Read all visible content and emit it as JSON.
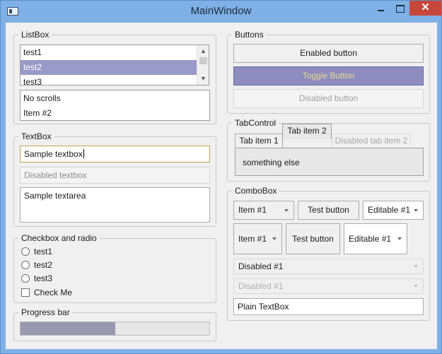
{
  "window": {
    "title": "MainWindow",
    "close_glyph": "✕"
  },
  "listbox_group": {
    "legend": "ListBox",
    "list1": [
      "test1",
      "test2",
      "test3"
    ],
    "list1_selected_index": 1,
    "list2": [
      "No scrolls",
      "Item #2"
    ]
  },
  "textbox_group": {
    "legend": "TextBox",
    "sample_textbox": "Sample textbox",
    "disabled_textbox": "Disabled textbox",
    "sample_textarea": "Sample textarea"
  },
  "checkbox_group": {
    "legend": "Checkbox and radio",
    "radios": [
      "test1",
      "test2",
      "test3"
    ],
    "checkbox_label": "Check Me",
    "checkbox_checked": false
  },
  "progress_group": {
    "legend": "Progress bar",
    "value_percent": 50
  },
  "buttons_group": {
    "legend": "Buttons",
    "enabled_label": "Enabled button",
    "toggle_label": "Toggle Button",
    "disabled_label": "Disabled button"
  },
  "tabcontrol_group": {
    "legend": "TabControl",
    "tabs": [
      "Tab item 1",
      "Tab item 2",
      "Disabled tab item 2"
    ],
    "selected_tab": 1,
    "content": "something else"
  },
  "combobox_group": {
    "legend": "ComboBox",
    "row1": {
      "combo": "Item #1",
      "button": "Test button",
      "editable": "Editable #1"
    },
    "row2": {
      "combo": "Item #1",
      "button": "Test button",
      "editable": "Editable #1"
    },
    "disabled_combo": "Disabled #1",
    "disabled_combo_dim": "Disabled #1",
    "plain_textbox": "Plain TextBox"
  },
  "icons": [
    "app-icon",
    "minimize-icon",
    "maximize-icon",
    "close-icon",
    "scroll-up-icon",
    "scroll-down-icon",
    "dropdown-chevron-icon"
  ]
}
